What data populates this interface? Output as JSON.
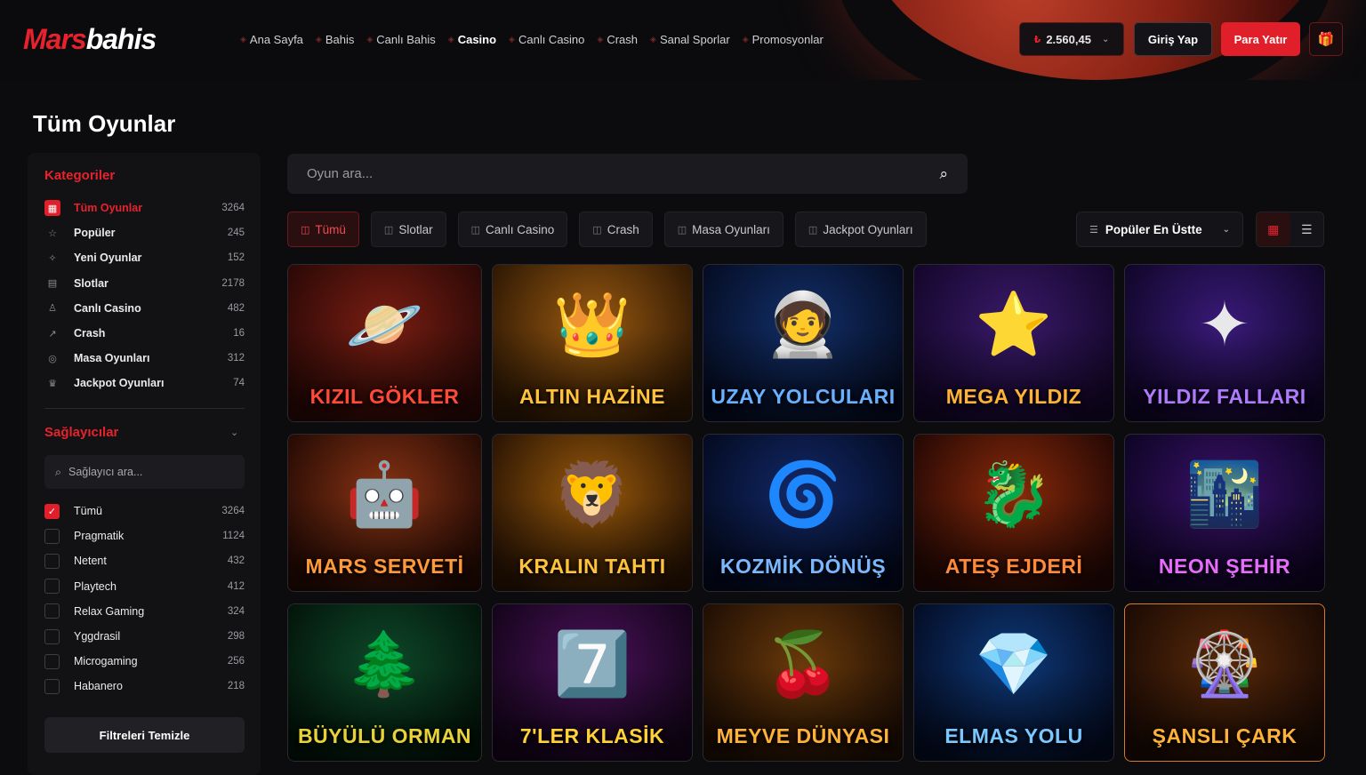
{
  "brand": {
    "part1": "Mars",
    "part2": "bahis"
  },
  "nav": [
    {
      "label": "Ana Sayfa",
      "icon": "home-icon",
      "active": false
    },
    {
      "label": "Bahis",
      "icon": "ticket-icon",
      "active": false
    },
    {
      "label": "Canlı Bahis",
      "icon": "live-icon",
      "active": false
    },
    {
      "label": "Casino",
      "icon": "casino-icon",
      "active": true
    },
    {
      "label": "Canlı Casino",
      "icon": "dealer-icon",
      "active": false
    },
    {
      "label": "Crash",
      "icon": "rocket-icon",
      "active": false
    },
    {
      "label": "Sanal Sporlar",
      "icon": "virtual-icon",
      "active": false
    },
    {
      "label": "Promosyonlar",
      "icon": "gift-icon",
      "active": false
    }
  ],
  "header": {
    "currency_symbol": "₺",
    "balance": "2.560,45",
    "login_label": "Giriş Yap",
    "deposit_label": "Para Yatır"
  },
  "page_title": "Tüm Oyunlar",
  "sidebar": {
    "categories_title": "Kategoriler",
    "categories": [
      {
        "label": "Tüm Oyunlar",
        "count": "3264",
        "icon": "grid-icon",
        "active": true
      },
      {
        "label": "Popüler",
        "count": "245",
        "icon": "star-icon",
        "active": false
      },
      {
        "label": "Yeni Oyunlar",
        "count": "152",
        "icon": "new-icon",
        "active": false
      },
      {
        "label": "Slotlar",
        "count": "2178",
        "icon": "slot-icon",
        "active": false
      },
      {
        "label": "Canlı Casino",
        "count": "482",
        "icon": "dealer-icon",
        "active": false
      },
      {
        "label": "Crash",
        "count": "16",
        "icon": "rocket-icon",
        "active": false
      },
      {
        "label": "Masa Oyunları",
        "count": "312",
        "icon": "chip-icon",
        "active": false
      },
      {
        "label": "Jackpot Oyunları",
        "count": "74",
        "icon": "jackpot-icon",
        "active": false
      }
    ],
    "providers_title": "Sağlayıcılar",
    "provider_search_placeholder": "Sağlayıcı ara...",
    "providers": [
      {
        "label": "Tümü",
        "count": "3264",
        "checked": true
      },
      {
        "label": "Pragmatik",
        "count": "1124",
        "checked": false
      },
      {
        "label": "Netent",
        "count": "432",
        "checked": false
      },
      {
        "label": "Playtech",
        "count": "412",
        "checked": false
      },
      {
        "label": "Relax Gaming",
        "count": "324",
        "checked": false
      },
      {
        "label": "Yggdrasil",
        "count": "298",
        "checked": false
      },
      {
        "label": "Microgaming",
        "count": "256",
        "checked": false
      },
      {
        "label": "Habanero",
        "count": "218",
        "checked": false
      }
    ],
    "clear_label": "Filtreleri Temizle"
  },
  "search": {
    "placeholder": "Oyun ara..."
  },
  "tabs": [
    {
      "label": "Tümü",
      "active": true
    },
    {
      "label": "Slotlar",
      "active": false
    },
    {
      "label": "Canlı Casino",
      "active": false
    },
    {
      "label": "Crash",
      "active": false
    },
    {
      "label": "Masa Oyunları",
      "active": false
    },
    {
      "label": "Jackpot Oyunları",
      "active": false
    }
  ],
  "sort": {
    "label": "Popüler En Üstte"
  },
  "games": [
    {
      "title": "KIZIL GÖKLER",
      "art": "🪐",
      "bg": "#7a1e12",
      "bg2": "#2a0806",
      "text": "#ff4a3a"
    },
    {
      "title": "ALTIN HAZİNE",
      "art": "👑",
      "bg": "#9a5a10",
      "bg2": "#2e1804",
      "text": "#ffc23a"
    },
    {
      "title": "UZAY YOLCULARI",
      "art": "🧑‍🚀",
      "bg": "#12306a",
      "bg2": "#050c22",
      "text": "#6ab0ff"
    },
    {
      "title": "MEGA YILDIZ",
      "art": "⭐",
      "bg": "#3a1a6a",
      "bg2": "#14062a",
      "text": "#ffb23a"
    },
    {
      "title": "YILDIZ FALLARI",
      "art": "✦",
      "bg": "#3a1a7a",
      "bg2": "#100628",
      "text": "#b07aff"
    },
    {
      "title": "MARS SERVETİ",
      "art": "🤖",
      "bg": "#8a3414",
      "bg2": "#240a04",
      "text": "#ff9a3a"
    },
    {
      "title": "KRALIN TAHTI",
      "art": "🦁",
      "bg": "#9a5a0a",
      "bg2": "#2a1404",
      "text": "#ffc23a"
    },
    {
      "title": "KOZMİK DÖNÜŞ",
      "art": "🌀",
      "bg": "#122a6a",
      "bg2": "#040a20",
      "text": "#7ab8ff"
    },
    {
      "title": "ATEŞ EJDERİ",
      "art": "🐉",
      "bg": "#8a2a0a",
      "bg2": "#240804",
      "text": "#ff8a3a"
    },
    {
      "title": "NEON ŞEHİR",
      "art": "🌃",
      "bg": "#3a126a",
      "bg2": "#0e0424",
      "text": "#e86aff"
    },
    {
      "title": "BÜYÜLÜ ORMAN",
      "art": "🌲",
      "bg": "#0e4a2a",
      "bg2": "#03140a",
      "text": "#e8d23a"
    },
    {
      "title": "7'LER KLASİK",
      "art": "7️⃣",
      "bg": "#4a125a",
      "bg2": "#14041a",
      "text": "#ffd23a"
    },
    {
      "title": "MEYVE DÜNYASI",
      "art": "🍒",
      "bg": "#6a3a0a",
      "bg2": "#1e0e04",
      "text": "#ffb23a"
    },
    {
      "title": "ELMAS YOLU",
      "art": "💎",
      "bg": "#0e3a7a",
      "bg2": "#040c24",
      "text": "#7ac8ff"
    },
    {
      "title": "ŞANSLI ÇARK",
      "art": "🎡",
      "bg": "#5a2a0a",
      "bg2": "#1a0a04",
      "text": "#ffb23a",
      "highlight": true
    }
  ]
}
